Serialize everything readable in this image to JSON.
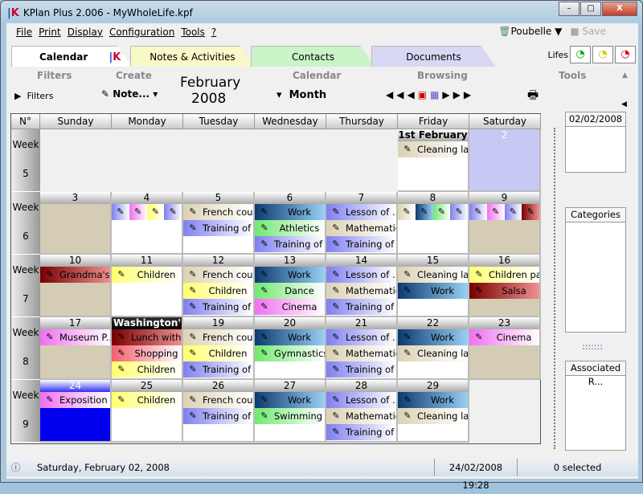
{
  "window": {
    "title": "KPlan Plus 2.006 - MyWholeLife.kpf",
    "minimize": "–",
    "maximize": "□",
    "close": "X"
  },
  "menu": [
    "File",
    "Print",
    "Display",
    "Configuration",
    "Tools",
    "?"
  ],
  "menu_right": {
    "trash": "Poubelle",
    "save": "Save"
  },
  "tabs": [
    {
      "label": "Calendar",
      "color": "#ffffff"
    },
    {
      "label": "Notes & Activities",
      "color": "#f8f8c8"
    },
    {
      "label": "Contacts",
      "color": "#c8f4c8"
    },
    {
      "label": "Documents",
      "color": "#d8d8f4"
    }
  ],
  "lifes": {
    "label": "Lifes",
    "items": [
      "green",
      "yellow",
      "red"
    ]
  },
  "toolbar": {
    "filters_group": "Filters",
    "create_group": "Create",
    "calendar_group": "Calendar",
    "browsing_group": "Browsing",
    "tools_group": "Tools",
    "filters": "Filters",
    "create": "Note...",
    "month_title": "February",
    "year": "2008",
    "view": "Month"
  },
  "calendar": {
    "corner": "N°",
    "weekdays": [
      "Sunday",
      "Monday",
      "Tuesday",
      "Wednesday",
      "Thursday",
      "Friday",
      "Saturday"
    ],
    "week_label": "Week",
    "colors": {
      "tan": "#dcd2b4",
      "lav": "#8080f0",
      "work": "#1a4a80",
      "green": "#70e870",
      "pink": "#f070f0",
      "yellow": "#ffff70",
      "red": "#801010",
      "rose": "#f06070"
    },
    "weeks": [
      {
        "num": "5",
        "days": [
          null,
          null,
          null,
          null,
          null,
          {
            "num": "1st February",
            "bold": true,
            "bg": "#ffffff",
            "events": [
              {
                "label": "Cleaning lady",
                "color": "tan"
              }
            ]
          },
          {
            "num": "2",
            "bg": "#c8c8f4",
            "selected": true,
            "events": []
          }
        ]
      },
      {
        "num": "6",
        "days": [
          {
            "num": "3",
            "bg": "#d4ccb4",
            "events": []
          },
          {
            "num": "4",
            "bg": "#ffffff",
            "icons": [
              "lav",
              "pink",
              "yellow",
              "lav"
            ]
          },
          {
            "num": "5",
            "bg": "#ffffff",
            "events": [
              {
                "label": "French cou...",
                "color": "tan"
              },
              {
                "label": "Training of ...",
                "color": "lav"
              }
            ]
          },
          {
            "num": "6",
            "bg": "#ffffff",
            "events": [
              {
                "label": "Work",
                "color": "work"
              },
              {
                "label": "Athletics",
                "color": "green"
              },
              {
                "label": "Training of ...",
                "color": "lav"
              }
            ]
          },
          {
            "num": "7",
            "bg": "#ffffff",
            "events": [
              {
                "label": "Lesson of ...",
                "color": "lav"
              },
              {
                "label": "Mathematics",
                "color": "tan"
              },
              {
                "label": "Training of ...",
                "color": "lav"
              }
            ]
          },
          {
            "num": "8",
            "bg": "#ffffff",
            "icons": [
              "tan",
              "work",
              "green",
              "lav"
            ]
          },
          {
            "num": "9",
            "bg": "#d4ccb4",
            "icons": [
              "lav",
              "pink",
              "lav",
              "red"
            ]
          }
        ]
      },
      {
        "num": "7",
        "days": [
          {
            "num": "10",
            "bg": "#d4ccb4",
            "events": [
              {
                "label": "Grandma's ...",
                "color": "red"
              }
            ]
          },
          {
            "num": "11",
            "bg": "#ffffff",
            "events": [
              {
                "label": "Children",
                "color": "yellow"
              }
            ]
          },
          {
            "num": "12",
            "bg": "#ffffff",
            "events": [
              {
                "label": "French cou...",
                "color": "tan"
              },
              {
                "label": "Children",
                "color": "yellow"
              },
              {
                "label": "Training of ...",
                "color": "lav"
              }
            ]
          },
          {
            "num": "13",
            "bg": "#ffffff",
            "events": [
              {
                "label": "Work",
                "color": "work"
              },
              {
                "label": "Dance",
                "color": "green"
              },
              {
                "label": "Cinema",
                "color": "pink"
              }
            ]
          },
          {
            "num": "14",
            "bg": "#ffffff",
            "events": [
              {
                "label": "Lesson of ...",
                "color": "lav"
              },
              {
                "label": "Mathematics",
                "color": "tan"
              },
              {
                "label": "Training of ...",
                "color": "lav"
              }
            ]
          },
          {
            "num": "15",
            "bg": "#ffffff",
            "events": [
              {
                "label": "Cleaning lady",
                "color": "tan"
              },
              {
                "label": "Work",
                "color": "work"
              }
            ]
          },
          {
            "num": "16",
            "bg": "#d4ccb4",
            "events": [
              {
                "label": "Children pa...",
                "color": "yellow"
              },
              {
                "label": "Salsa",
                "color": "red"
              }
            ]
          }
        ]
      },
      {
        "num": "8",
        "days": [
          {
            "num": "17",
            "bg": "#d4ccb4",
            "events": [
              {
                "label": "Museum P...",
                "color": "pink"
              }
            ]
          },
          {
            "num": "Washington'...",
            "holiday": true,
            "bg": "#ffffff",
            "events": [
              {
                "label": "Lunch with...",
                "color": "red"
              },
              {
                "label": "Shopping",
                "color": "rose"
              },
              {
                "label": "Children",
                "color": "yellow"
              }
            ]
          },
          {
            "num": "19",
            "bg": "#ffffff",
            "events": [
              {
                "label": "French cou...",
                "color": "tan"
              },
              {
                "label": "Children",
                "color": "yellow"
              },
              {
                "label": "Training of ...",
                "color": "lav"
              }
            ]
          },
          {
            "num": "20",
            "bg": "#ffffff",
            "events": [
              {
                "label": "Work",
                "color": "work"
              },
              {
                "label": "Gymnastics",
                "color": "green"
              }
            ]
          },
          {
            "num": "21",
            "bg": "#ffffff",
            "events": [
              {
                "label": "Lesson of ...",
                "color": "lav"
              },
              {
                "label": "Mathematics",
                "color": "tan"
              },
              {
                "label": "Training of ...",
                "color": "lav"
              }
            ]
          },
          {
            "num": "22",
            "bg": "#ffffff",
            "events": [
              {
                "label": "Work",
                "color": "work"
              },
              {
                "label": "Cleaning lady",
                "color": "tan"
              }
            ]
          },
          {
            "num": "23",
            "bg": "#d4ccb4",
            "events": [
              {
                "label": "Cinema",
                "color": "pink"
              }
            ]
          }
        ]
      },
      {
        "num": "9",
        "days": [
          {
            "num": "24",
            "today": true,
            "bg": "#0000ee",
            "events": [
              {
                "label": "Exposition r...",
                "color": "pink"
              }
            ]
          },
          {
            "num": "25",
            "bg": "#ffffff",
            "events": [
              {
                "label": "Children",
                "color": "yellow"
              }
            ]
          },
          {
            "num": "26",
            "bg": "#ffffff",
            "events": [
              {
                "label": "French cou...",
                "color": "tan"
              },
              {
                "label": "Training of ...",
                "color": "lav"
              }
            ]
          },
          {
            "num": "27",
            "bg": "#ffffff",
            "events": [
              {
                "label": "Work",
                "color": "work"
              },
              {
                "label": "Swimming ...",
                "color": "green"
              }
            ]
          },
          {
            "num": "28",
            "bg": "#ffffff",
            "events": [
              {
                "label": "Lesson of ...",
                "color": "lav"
              },
              {
                "label": "Mathematics",
                "color": "tan"
              },
              {
                "label": "Training of ...",
                "color": "lav"
              }
            ]
          },
          {
            "num": "29",
            "bg": "#ffffff",
            "events": [
              {
                "label": "Work",
                "color": "work"
              },
              {
                "label": "Cleaning lady",
                "color": "tan"
              }
            ]
          },
          null
        ]
      }
    ]
  },
  "side": {
    "date": "02/02/2008",
    "categories": "Categories",
    "associated": "Associated R...",
    "dots": ":::::::"
  },
  "status": {
    "date": "Saturday, February 02, 2008",
    "datetime": "24/02/2008 19:28",
    "selected": "0 selected"
  }
}
